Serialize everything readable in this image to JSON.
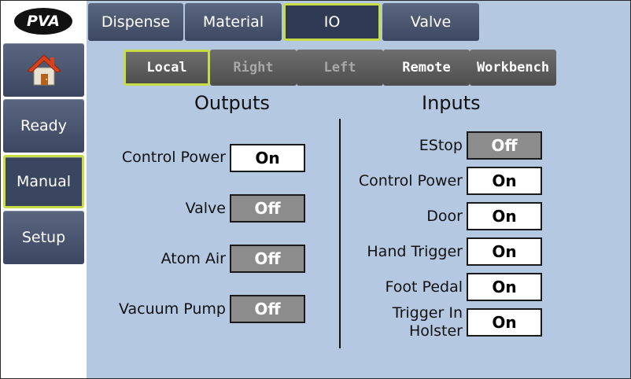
{
  "logo": {
    "text": "PVA"
  },
  "sidebar": {
    "home_icon": "home-icon",
    "items": [
      {
        "label": "Ready",
        "active": false
      },
      {
        "label": "Manual",
        "active": true
      },
      {
        "label": "Setup",
        "active": false
      }
    ]
  },
  "top_tabs": [
    {
      "label": "Dispense",
      "active": false
    },
    {
      "label": "Material",
      "active": false
    },
    {
      "label": "IO",
      "active": true
    },
    {
      "label": "Valve",
      "active": false
    }
  ],
  "sub_tabs": [
    {
      "label": "Local",
      "state": "active"
    },
    {
      "label": "Right",
      "state": "disabled"
    },
    {
      "label": "Left",
      "state": "disabled"
    },
    {
      "label": "Remote",
      "state": "normal"
    },
    {
      "label": "Workbench",
      "state": "normal"
    }
  ],
  "outputs": {
    "title": "Outputs",
    "items": [
      {
        "label": "Control Power",
        "state": "On"
      },
      {
        "label": "Valve",
        "state": "Off"
      },
      {
        "label": "Atom Air",
        "state": "Off"
      },
      {
        "label": "Vacuum Pump",
        "state": "Off"
      }
    ]
  },
  "inputs": {
    "title": "Inputs",
    "items": [
      {
        "label": "EStop",
        "state": "Off"
      },
      {
        "label": "Control Power",
        "state": "On"
      },
      {
        "label": "Door",
        "state": "On"
      },
      {
        "label": "Hand Trigger",
        "state": "On"
      },
      {
        "label": "Foot Pedal",
        "state": "On"
      },
      {
        "label_line1": "Trigger In",
        "label_line2": "Holster",
        "state": "On"
      }
    ]
  },
  "colors": {
    "background": "#b4c8e2",
    "active_border": "#c8dc46",
    "on_fill": "#ffffff",
    "off_fill": "#8c8c8c"
  }
}
